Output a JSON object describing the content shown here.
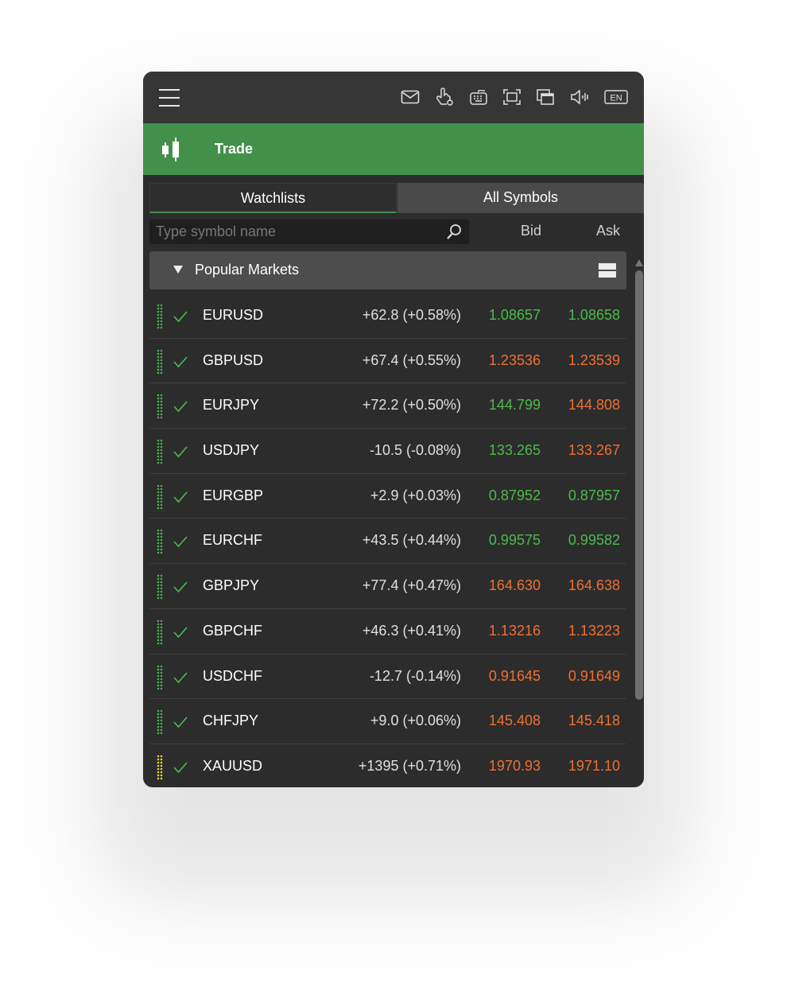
{
  "header": {
    "title": "Trade"
  },
  "tabs": [
    {
      "label": "Watchlists"
    },
    {
      "label": "All Symbols"
    }
  ],
  "search": {
    "placeholder": "Type symbol name"
  },
  "columns": {
    "bid": "Bid",
    "ask": "Ask"
  },
  "group": {
    "title": "Popular Markets"
  },
  "toolbar_icons": [
    "mail-icon",
    "touch-settings-icon",
    "keyboard-icon",
    "fullscreen-icon",
    "windows-icon",
    "volume-icon",
    "language-en-icon"
  ],
  "language": "EN",
  "colors": {
    "green": "#4cbb4c",
    "orange": "#f07030",
    "accent": "#43904a"
  },
  "rows": [
    {
      "symbol": "EURUSD",
      "change": "+62.8 (+0.58%)",
      "bid": "1.08657",
      "ask": "1.08658",
      "bid_dir": "up",
      "ask_dir": "up"
    },
    {
      "symbol": "GBPUSD",
      "change": "+67.4 (+0.55%)",
      "bid": "1.23536",
      "ask": "1.23539",
      "bid_dir": "down",
      "ask_dir": "down"
    },
    {
      "symbol": "EURJPY",
      "change": "+72.2 (+0.50%)",
      "bid": "144.799",
      "ask": "144.808",
      "bid_dir": "up",
      "ask_dir": "down"
    },
    {
      "symbol": "USDJPY",
      "change": "-10.5 (-0.08%)",
      "bid": "133.265",
      "ask": "133.267",
      "bid_dir": "up",
      "ask_dir": "down"
    },
    {
      "symbol": "EURGBP",
      "change": "+2.9 (+0.03%)",
      "bid": "0.87952",
      "ask": "0.87957",
      "bid_dir": "up",
      "ask_dir": "up"
    },
    {
      "symbol": "EURCHF",
      "change": "+43.5 (+0.44%)",
      "bid": "0.99575",
      "ask": "0.99582",
      "bid_dir": "up",
      "ask_dir": "up"
    },
    {
      "symbol": "GBPJPY",
      "change": "+77.4 (+0.47%)",
      "bid": "164.630",
      "ask": "164.638",
      "bid_dir": "down",
      "ask_dir": "down"
    },
    {
      "symbol": "GBPCHF",
      "change": "+46.3 (+0.41%)",
      "bid": "1.13216",
      "ask": "1.13223",
      "bid_dir": "down",
      "ask_dir": "down"
    },
    {
      "symbol": "USDCHF",
      "change": "-12.7 (-0.14%)",
      "bid": "0.91645",
      "ask": "0.91649",
      "bid_dir": "down",
      "ask_dir": "down"
    },
    {
      "symbol": "CHFJPY",
      "change": "+9.0 (+0.06%)",
      "bid": "145.408",
      "ask": "145.418",
      "bid_dir": "down",
      "ask_dir": "down"
    },
    {
      "symbol": "XAUUSD",
      "change": "+1395 (+0.71%)",
      "bid": "1970.93",
      "ask": "1971.10",
      "bid_dir": "down",
      "ask_dir": "down",
      "handle": "yellow"
    }
  ]
}
